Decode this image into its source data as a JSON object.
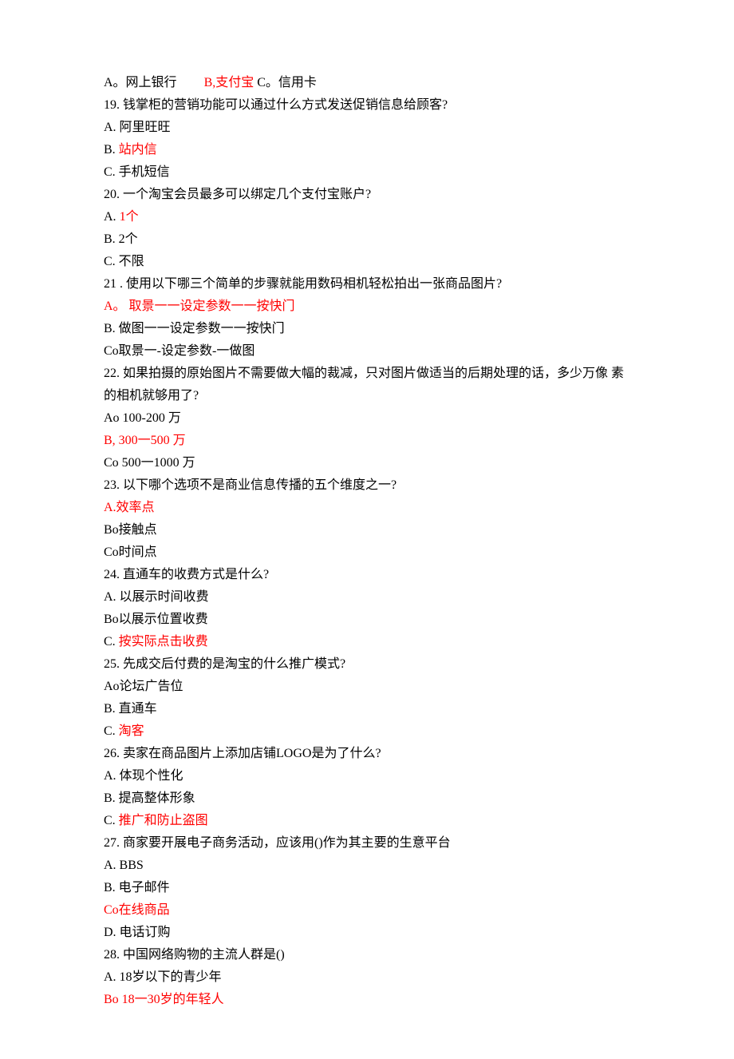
{
  "lines": [
    {
      "parts": [
        {
          "text": "A。网上银行",
          "red": false
        },
        {
          "text": "",
          "gap": true
        },
        {
          "text": "B,支付宝",
          "red": true
        },
        {
          "text": " C。信用卡",
          "red": false
        }
      ]
    },
    {
      "parts": [
        {
          "text": "19. 钱掌柜的营销功能可以通过什么方式发送促销信息给顾客?",
          "red": false
        }
      ]
    },
    {
      "parts": [
        {
          "text": "A. 阿里旺旺",
          "red": false
        }
      ]
    },
    {
      "parts": [
        {
          "text": "B. ",
          "red": false
        },
        {
          "text": "站内信",
          "red": true
        }
      ]
    },
    {
      "parts": [
        {
          "text": "C. 手机短信",
          "red": false
        }
      ]
    },
    {
      "parts": [
        {
          "text": "20.  一个淘宝会员最多可以绑定几个支付宝账户?",
          "red": false
        }
      ]
    },
    {
      "parts": [
        {
          "text": "A. ",
          "red": false
        },
        {
          "text": "1个",
          "red": true
        }
      ]
    },
    {
      "parts": [
        {
          "text": "B.  2个",
          "red": false
        }
      ]
    },
    {
      "parts": [
        {
          "text": "C. 不限",
          "red": false
        }
      ]
    },
    {
      "parts": [
        {
          "text": "21 . 使用以下哪三个简单的步骤就能用数码相机轻松拍出一张商品图片?",
          "red": false
        }
      ]
    },
    {
      "parts": [
        {
          "text": "A。 取景一一设定参数一一按快门",
          "red": true
        }
      ]
    },
    {
      "parts": [
        {
          "text": "B. 做图一一设定参数一一按快门",
          "red": false
        }
      ]
    },
    {
      "parts": [
        {
          "text": "Co取景一-设定参数-一做图",
          "red": false
        }
      ]
    },
    {
      "parts": [
        {
          "text": "22.  如果拍摄的原始图片不需要做大幅的裁减，只对图片做适当的后期处理的话，多少万像 素的相机就够用了?",
          "red": false,
          "wrap": true
        }
      ]
    },
    {
      "parts": [
        {
          "text": "Ao 100-200 万",
          "red": false
        }
      ]
    },
    {
      "parts": [
        {
          "text": "B,  300一500 万",
          "red": true
        }
      ]
    },
    {
      "parts": [
        {
          "text": "Co 500一1000 万",
          "red": false
        }
      ]
    },
    {
      "parts": [
        {
          "text": "23.  以下哪个选项不是商业信息传播的五个维度之一?",
          "red": false
        }
      ]
    },
    {
      "parts": [
        {
          "text": "A.效率点",
          "red": true
        }
      ]
    },
    {
      "parts": [
        {
          "text": "Bo接触点",
          "red": false
        }
      ]
    },
    {
      "parts": [
        {
          "text": "Co时间点",
          "red": false
        }
      ]
    },
    {
      "parts": [
        {
          "text": "24.  直通车的收费方式是什么?",
          "red": false
        }
      ]
    },
    {
      "parts": [
        {
          "text": "A. 以展示时间收费",
          "red": false
        }
      ]
    },
    {
      "parts": [
        {
          "text": "Bo以展示位置收费",
          "red": false
        }
      ]
    },
    {
      "parts": [
        {
          "text": "C. ",
          "red": false
        },
        {
          "text": "按实际点击收费",
          "red": true
        }
      ]
    },
    {
      "parts": [
        {
          "text": "25.  先成交后付费的是淘宝的什么推广模式?",
          "red": false
        }
      ]
    },
    {
      "parts": [
        {
          "text": "Ao论坛广告位",
          "red": false
        }
      ]
    },
    {
      "parts": [
        {
          "text": "B. 直通车",
          "red": false
        }
      ]
    },
    {
      "parts": [
        {
          "text": "C. ",
          "red": false
        },
        {
          "text": "淘客",
          "red": true
        }
      ]
    },
    {
      "parts": [
        {
          "text": "26.  卖家在商品图片上添加店铺LOGO是为了什么?",
          "red": false
        }
      ]
    },
    {
      "parts": [
        {
          "text": "A. 体现个性化",
          "red": false
        }
      ]
    },
    {
      "parts": [
        {
          "text": "B. 提高整体形象",
          "red": false
        }
      ]
    },
    {
      "parts": [
        {
          "text": "C. ",
          "red": false
        },
        {
          "text": "推广和防止盗图",
          "red": true
        }
      ]
    },
    {
      "parts": [
        {
          "text": "27.  商家要开展电子商务活动，应该用()作为其主要的生意平台",
          "red": false
        }
      ]
    },
    {
      "parts": [
        {
          "text": "A.  BBS",
          "red": false
        }
      ]
    },
    {
      "parts": [
        {
          "text": "B. 电子邮件",
          "red": false
        }
      ]
    },
    {
      "parts": [
        {
          "text": "Co在线商品",
          "red": true
        }
      ]
    },
    {
      "parts": [
        {
          "text": "D. 电话订购",
          "red": false
        }
      ]
    },
    {
      "parts": [
        {
          "text": "28.  中国网络购物的主流人群是()",
          "red": false
        }
      ]
    },
    {
      "parts": [
        {
          "text": "A. 18岁以下的青少年",
          "red": false
        }
      ]
    },
    {
      "parts": [
        {
          "text": "Bo 18一30岁的年轻人",
          "red": true
        }
      ]
    }
  ]
}
